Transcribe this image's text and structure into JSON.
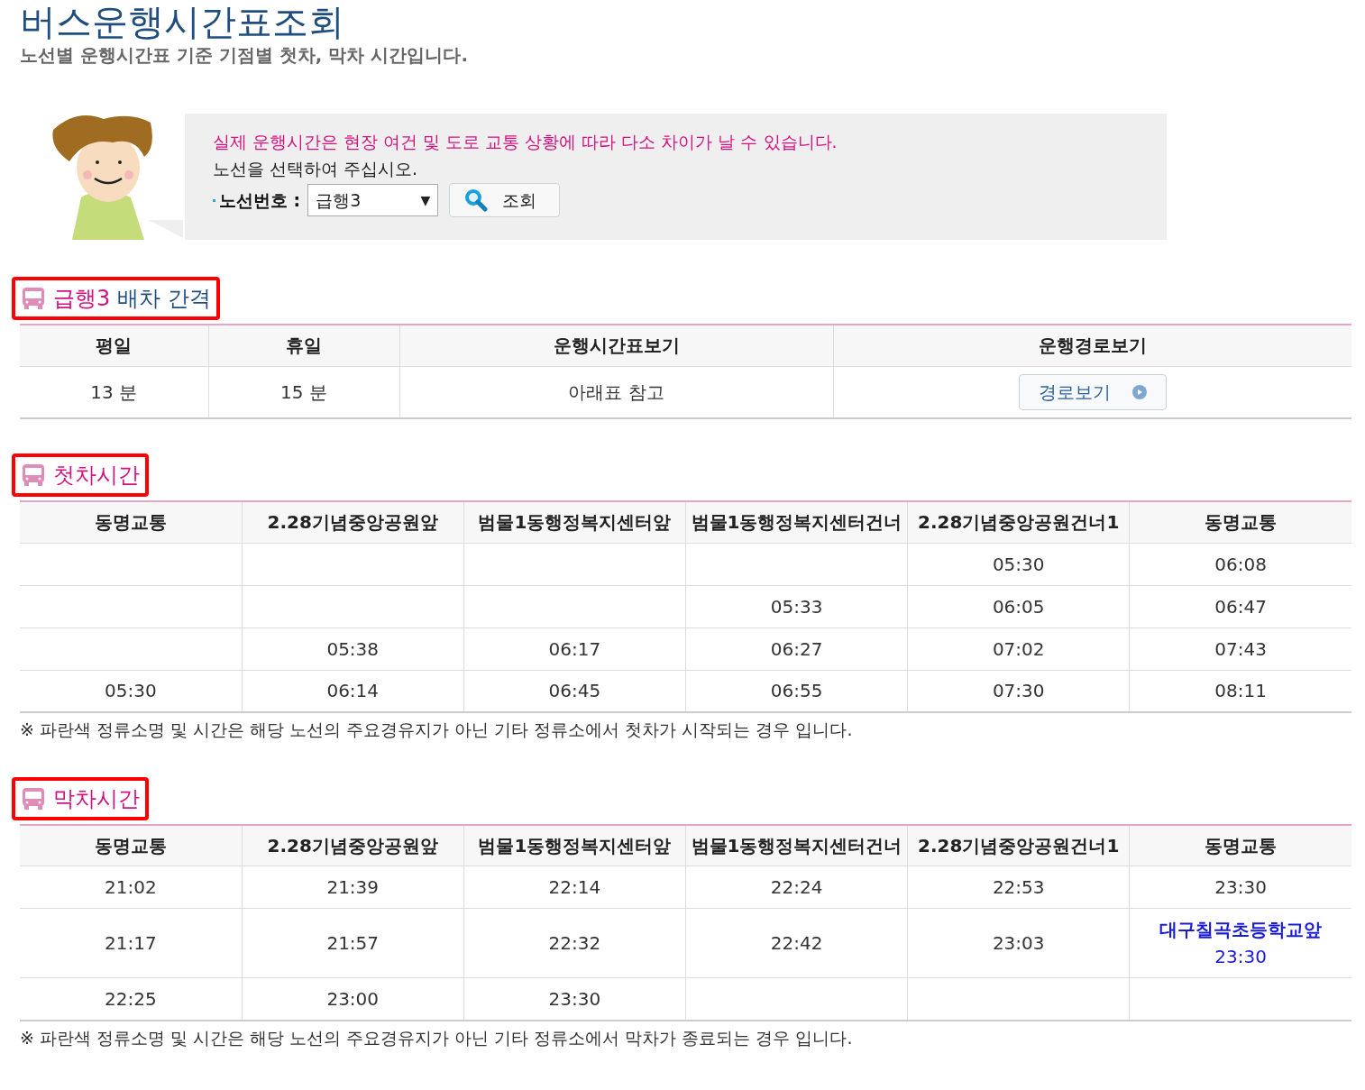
{
  "page": {
    "title": "버스운행시간표조회",
    "subtitle": "노선별 운행시간표 기준 기점별 첫차, 막차 시간입니다."
  },
  "notice": {
    "warning": "실제 운행시간은 현장 여건 및 도로 교통 상황에 따라 다소 차이가 날 수 있습니다.",
    "instruction": "노선을 선택하여 주십시오.",
    "route_label": "노선번호 :",
    "route_value": "급행3",
    "route_caret": "▼",
    "search_button": "조회"
  },
  "interval": {
    "heading_route": "급행3",
    "heading_text": "배차 간격",
    "columns": [
      "평일",
      "휴일",
      "운행시간표보기",
      "운행경로보기"
    ],
    "row": {
      "weekday": "13 분",
      "holiday": "15 분",
      "timetable": "아래표 참고",
      "route_button": "경로보기"
    }
  },
  "sections": [
    {
      "heading": "첫차시간",
      "columns": [
        "동명교통",
        "2.28기념중앙공원앞",
        "범물1동행정복지센터앞",
        "범물1동행정복지센터건너",
        "2.28기념중앙공원건너1",
        "동명교통"
      ],
      "rows": [
        [
          null,
          null,
          null,
          null,
          "05:30",
          "06:08"
        ],
        [
          null,
          null,
          null,
          "05:33",
          "06:05",
          "06:47"
        ],
        [
          null,
          "05:38",
          "06:17",
          "06:27",
          "07:02",
          "07:43"
        ],
        [
          "05:30",
          "06:14",
          "06:45",
          "06:55",
          "07:30",
          "08:11"
        ]
      ],
      "note": "※ 파란색 정류소명 및 시간은 해당 노선의 주요경유지가 아닌 기타 정류소에서 첫차가 시작되는 경우 입니다."
    },
    {
      "heading": "막차시간",
      "columns": [
        "동명교통",
        "2.28기념중앙공원앞",
        "범물1동행정복지센터앞",
        "범물1동행정복지센터건너",
        "2.28기념중앙공원건너1",
        "동명교통"
      ],
      "rows": [
        [
          "21:02",
          "21:39",
          "22:14",
          "22:24",
          "22:53",
          "23:30"
        ],
        [
          "21:17",
          "21:57",
          "22:32",
          "22:42",
          "23:03",
          {
            "kind": "other_stop",
            "stop": "대구칠곡초등학교앞",
            "time": "23:30"
          }
        ],
        [
          "22:25",
          "23:00",
          "23:30",
          null,
          null,
          null
        ]
      ],
      "note": "※ 파란색 정류소명 및 시간은 해당 노선의 주요경유지가 아닌 기타 정류소에서 막차가 종료되는 경우 입니다."
    }
  ]
}
